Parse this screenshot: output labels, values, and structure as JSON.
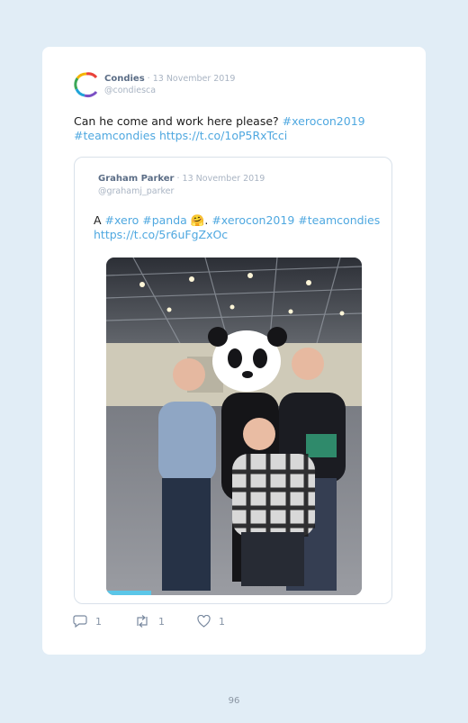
{
  "tweet": {
    "author_name": "Condies",
    "date": " · 13 November 2019",
    "handle": "@condiesca",
    "text": "Can he come and work here please? ",
    "hashtag1": "#xerocon2019",
    "hashtag2": "#teamcondies",
    "link": "https://t.co/1oP5RxTcci",
    "avatar_icon": "condies-logo-icon"
  },
  "quoted": {
    "author_name": "Graham Parker",
    "date": " · 13 November 2019",
    "handle": "@grahamj_parker",
    "text_prefix": "A ",
    "hashtag_xero": "#xero",
    "hashtag_panda": "#panda",
    "emoji": "🤗",
    "hashtag_xerocon": "#xerocon2019",
    "hashtag_team": "#teamcondies",
    "link": "https://t.co/5r6uFgZxOc",
    "photo_icon": "event-photo-panda-mascot"
  },
  "actions": {
    "reply_count": "1",
    "retweet_count": "1",
    "like_count": "1"
  },
  "page_number": "96",
  "colors": {
    "background": "#e1edf6",
    "card": "#ffffff",
    "link": "#4fa8e0",
    "name": "#5b6d86",
    "muted": "#a9b4c3"
  }
}
